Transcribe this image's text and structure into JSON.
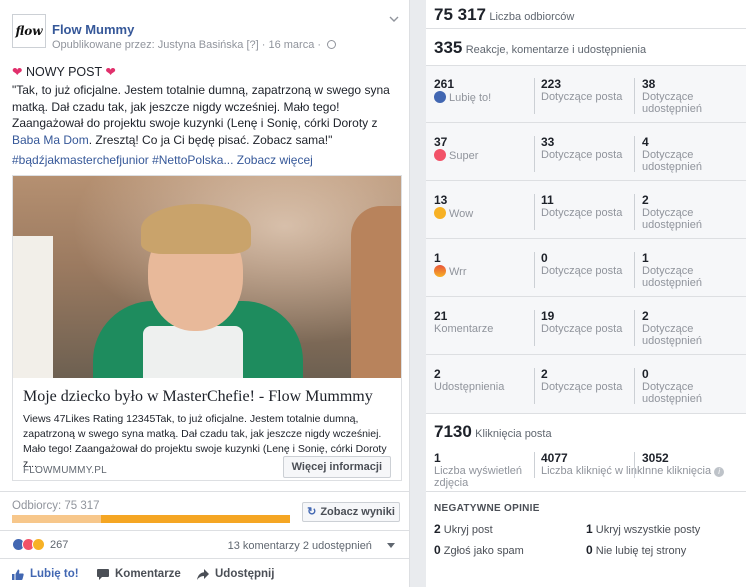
{
  "post": {
    "page_name": "Flow Mummy",
    "avatar_text": "flow",
    "published_by": "Opublikowane przez: Justyna Basińska",
    "meta_mark": "[?]",
    "date": "· 16 marca ·",
    "title_left": "❤",
    "title_text": " NOWY POST ",
    "title_right": "❤",
    "body_1": "\"Tak, to już oficjalne. Jestem totalnie dumną, zapatrzoną w swego syna matką. Dał czadu tak, jak jeszcze nigdy wcześniej. Mało tego! Zaangażował do projektu swoje kuzynki (Lenę i Sonię, córki Doroty z ",
    "body_link": "Baba Ma Dom",
    "body_2": ". Zresztą! Co ja Ci będę pisać. Zobacz sama!\"",
    "hashtags": "#bądźjakmasterchefjunior #NettoPolska",
    "see_more": "... Zobacz więcej",
    "card": {
      "title": "Moje dziecko było w MasterChefie! - Flow Mummmy",
      "description": "Views 47Likes Rating 12345Tak, to już oficjalne. Jestem totalnie dumną, zapatrzoną w swego syna matką. Dał czadu tak, jak jeszcze nigdy wcześniej. Mało tego! Zaangażował do projektu swoje kuzynki (Lenę i Sonię, córki Doroty z...",
      "domain": "FLOWMUMMY.PL",
      "button": "Więcej informacji"
    },
    "reach_label": "Odbiorcy: 75 317",
    "reach_organic_fraction": 0.32,
    "results_button": "Zobacz wyniki",
    "reaction_count": "267",
    "comments": "13 komentarzy",
    "shares": "2 udostępnień",
    "actions": {
      "like": "Lubię to!",
      "comment": "Komentarze",
      "share": "Udostępnij"
    }
  },
  "stats": {
    "reach_value": "75 317",
    "reach_label": "Liczba odbiorców",
    "engagement_value": "335",
    "engagement_label": "Reakcje, komentarze i udostępnienia",
    "rows": [
      {
        "icon": "like-icon",
        "total": "261",
        "label": "Lubię to!",
        "on_post": "223",
        "on_post_label": "Dotyczące posta",
        "on_shares": "38",
        "on_shares_label": "Dotyczące udostępnień"
      },
      {
        "icon": "love-icon",
        "total": "37",
        "label": "Super",
        "on_post": "33",
        "on_post_label": "Dotyczące posta",
        "on_shares": "4",
        "on_shares_label": "Dotyczące udostępnień"
      },
      {
        "icon": "wow-icon",
        "total": "13",
        "label": "Wow",
        "on_post": "11",
        "on_post_label": "Dotyczące posta",
        "on_shares": "2",
        "on_shares_label": "Dotyczące udostępnień"
      },
      {
        "icon": "angry-icon",
        "total": "1",
        "label": "Wrr",
        "on_post": "0",
        "on_post_label": "Dotyczące posta",
        "on_shares": "1",
        "on_shares_label": "Dotyczące udostępnień"
      },
      {
        "icon": "",
        "total": "21",
        "label": "Komentarze",
        "on_post": "19",
        "on_post_label": "Dotyczące posta",
        "on_shares": "2",
        "on_shares_label": "Dotyczące udostępnień"
      },
      {
        "icon": "",
        "total": "2",
        "label": "Udostępnienia",
        "on_post": "2",
        "on_post_label": "Dotyczące posta",
        "on_shares": "0",
        "on_shares_label": "Dotyczące udostępnień"
      }
    ],
    "clicks_value": "7130",
    "clicks_label": "Kliknięcia posta",
    "photo_views": "1",
    "photo_views_label": "Liczba wyświetleń zdjęcia",
    "link_clicks": "4077",
    "link_clicks_label": "Liczba kliknięć w link",
    "other_clicks": "3052",
    "other_clicks_label": "Inne kliknięcia",
    "info_glyph": "i",
    "negative_title": "NEGATYWNE OPINIE",
    "hide_post_n": "2",
    "hide_post": "Ukryj post",
    "hide_all_n": "1",
    "hide_all": "Ukryj wszystkie posty",
    "spam_n": "0",
    "spam": "Zgłoś jako spam",
    "unlike_n": "0",
    "unlike": "Nie lubię tej strony"
  },
  "colors": {
    "brand": "#4267b2",
    "link": "#365899",
    "bar_paid": "#f5a623",
    "bar_organic": "#f7c78b"
  }
}
